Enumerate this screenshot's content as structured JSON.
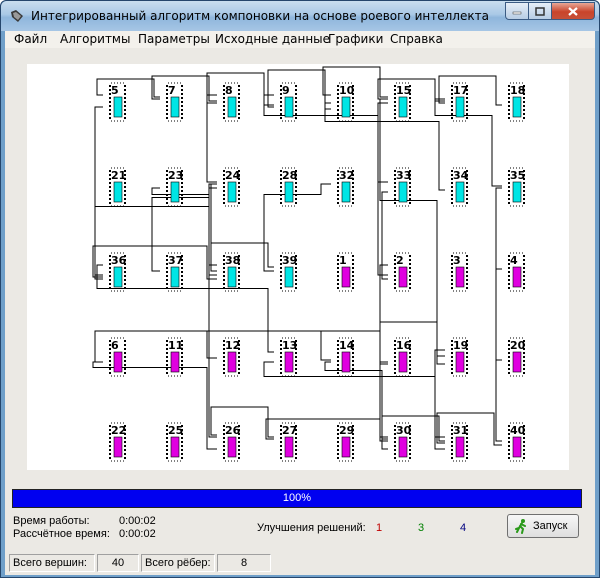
{
  "window": {
    "title": "Интегрированный алгоритм компоновки на основе роевого интеллекта"
  },
  "menu": [
    {
      "label": "Файл"
    },
    {
      "label": "Алгоритмы"
    },
    {
      "label": "Параметры"
    },
    {
      "label": "Исходные данные"
    },
    {
      "label": "Графики"
    },
    {
      "label": "Справка"
    }
  ],
  "colors": {
    "cyan_block": "#00e5e5",
    "magenta_block": "#e000e0",
    "wire": "#000000",
    "progress": "#0000f0"
  },
  "layout_grid": {
    "rows": [
      [
        {
          "n": "5",
          "c": "cyan"
        },
        {
          "n": "7",
          "c": "cyan"
        },
        {
          "n": "8",
          "c": "cyan"
        },
        {
          "n": "9",
          "c": "cyan"
        },
        {
          "n": "10",
          "c": "cyan"
        },
        {
          "n": "15",
          "c": "cyan"
        },
        {
          "n": "17",
          "c": "cyan"
        },
        {
          "n": "18",
          "c": "cyan"
        }
      ],
      [
        {
          "n": "21",
          "c": "cyan"
        },
        {
          "n": "23",
          "c": "cyan"
        },
        {
          "n": "24",
          "c": "cyan"
        },
        {
          "n": "28",
          "c": "cyan"
        },
        {
          "n": "32",
          "c": "cyan"
        },
        {
          "n": "33",
          "c": "cyan"
        },
        {
          "n": "34",
          "c": "cyan"
        },
        {
          "n": "35",
          "c": "cyan"
        }
      ],
      [
        {
          "n": "36",
          "c": "cyan"
        },
        {
          "n": "37",
          "c": "cyan"
        },
        {
          "n": "38",
          "c": "cyan"
        },
        {
          "n": "39",
          "c": "cyan"
        },
        {
          "n": "1",
          "c": "magenta"
        },
        {
          "n": "2",
          "c": "magenta"
        },
        {
          "n": "3",
          "c": "magenta"
        },
        {
          "n": "4",
          "c": "magenta"
        }
      ],
      [
        {
          "n": "6",
          "c": "magenta"
        },
        {
          "n": "11",
          "c": "magenta"
        },
        {
          "n": "12",
          "c": "magenta"
        },
        {
          "n": "13",
          "c": "magenta"
        },
        {
          "n": "14",
          "c": "magenta"
        },
        {
          "n": "16",
          "c": "magenta"
        },
        {
          "n": "19",
          "c": "magenta"
        },
        {
          "n": "20",
          "c": "magenta"
        }
      ],
      [
        {
          "n": "22",
          "c": "magenta"
        },
        {
          "n": "25",
          "c": "magenta"
        },
        {
          "n": "26",
          "c": "magenta"
        },
        {
          "n": "27",
          "c": "magenta"
        },
        {
          "n": "29",
          "c": "magenta"
        },
        {
          "n": "30",
          "c": "magenta"
        },
        {
          "n": "31",
          "c": "magenta"
        },
        {
          "n": "40",
          "c": "magenta"
        }
      ]
    ]
  },
  "progress": {
    "text": "100%",
    "value": 100
  },
  "info": {
    "work_time_label": "Время работы:",
    "work_time_value": "0:00:02",
    "calc_time_label": "Рассчётное время:",
    "calc_time_value": "0:00:02",
    "improvements_label": "Улучшения решений:",
    "improvements": [
      {
        "value": "1",
        "color": "#c00000"
      },
      {
        "value": "3",
        "color": "#008000"
      },
      {
        "value": "4",
        "color": "#000080"
      }
    ]
  },
  "run_button": {
    "label": "Запуск",
    "icon": "runner-icon"
  },
  "status": {
    "vertices_label": "Всего вершин:",
    "vertices_value": "40",
    "edges_label": "Всего рёбер:",
    "edges_value": "8"
  }
}
